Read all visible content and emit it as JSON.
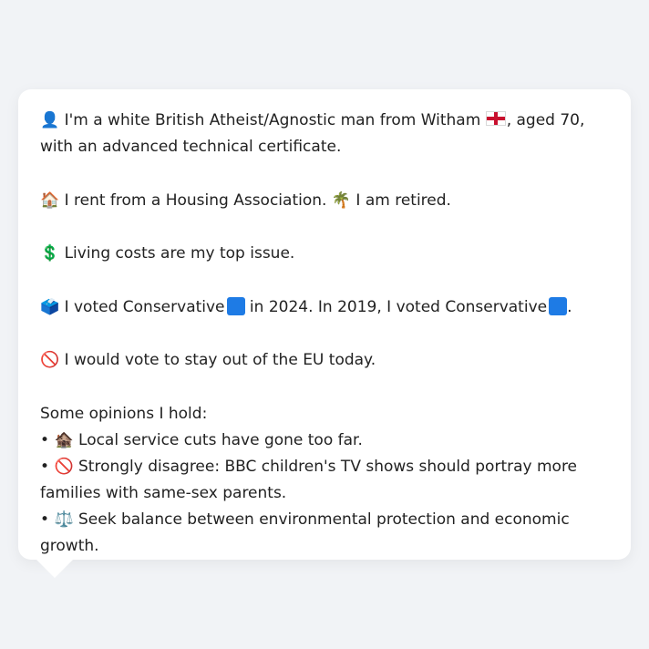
{
  "profile": {
    "intro": {
      "icon": "👤",
      "text_a": "I'm a white British Atheist/Agnostic man from Witham",
      "flag_icon": "england-flag",
      "text_b": ", aged 70, with an advanced technical certificate."
    },
    "housing": {
      "icon": "🏠",
      "text": "I rent from a Housing Association.",
      "icon2": "🌴",
      "text2": "I am retired."
    },
    "issue": {
      "icon": "💲",
      "text": "Living costs are my top issue."
    },
    "vote": {
      "icon": "🗳️",
      "text_a": "I voted Conservative",
      "text_b": "in 2024. In 2019, I voted Conservative",
      "text_c": ".",
      "party_color": "#1e7be5"
    },
    "eu": {
      "icon": "🚫",
      "text": "I would vote to stay out of the EU today."
    },
    "opinions_heading": "Some opinions I hold:",
    "opinions": [
      {
        "bullet": "•",
        "icon": "🏚️",
        "text": "Local service cuts have gone too far."
      },
      {
        "bullet": "•",
        "icon": "🚫",
        "text": "Strongly disagree: BBC children's TV shows should portray more families with same-sex parents."
      },
      {
        "bullet": "•",
        "icon": "⚖️",
        "text": "Seek balance between environmental protection and economic growth."
      }
    ]
  }
}
